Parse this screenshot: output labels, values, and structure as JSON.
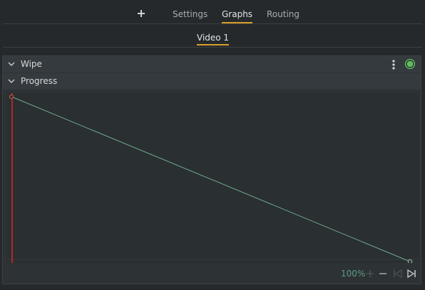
{
  "tabs": [
    {
      "label": "Settings",
      "active": false
    },
    {
      "label": "Graphs",
      "active": true
    },
    {
      "label": "Routing",
      "active": false
    }
  ],
  "subtab": {
    "label": "Video 1"
  },
  "sections": {
    "wipe": {
      "label": "Wipe"
    },
    "progress": {
      "label": "Progress"
    }
  },
  "graph": {
    "keyframes": [
      {
        "t": 0.0,
        "value": 1.0
      },
      {
        "t": 1.0,
        "value": 0.0
      }
    ],
    "playhead_t": 0.0,
    "colors": {
      "curve": "#6fa88c",
      "playhead": "#b3252b",
      "keyframe_start": "#c0533a",
      "keyframe_end": "#8fb6a3"
    }
  },
  "footer": {
    "zoom": "100%"
  },
  "colors": {
    "accent": "#d89f2a",
    "enabled": "#5fbf5a",
    "zoom_text": "#5f9c83"
  }
}
